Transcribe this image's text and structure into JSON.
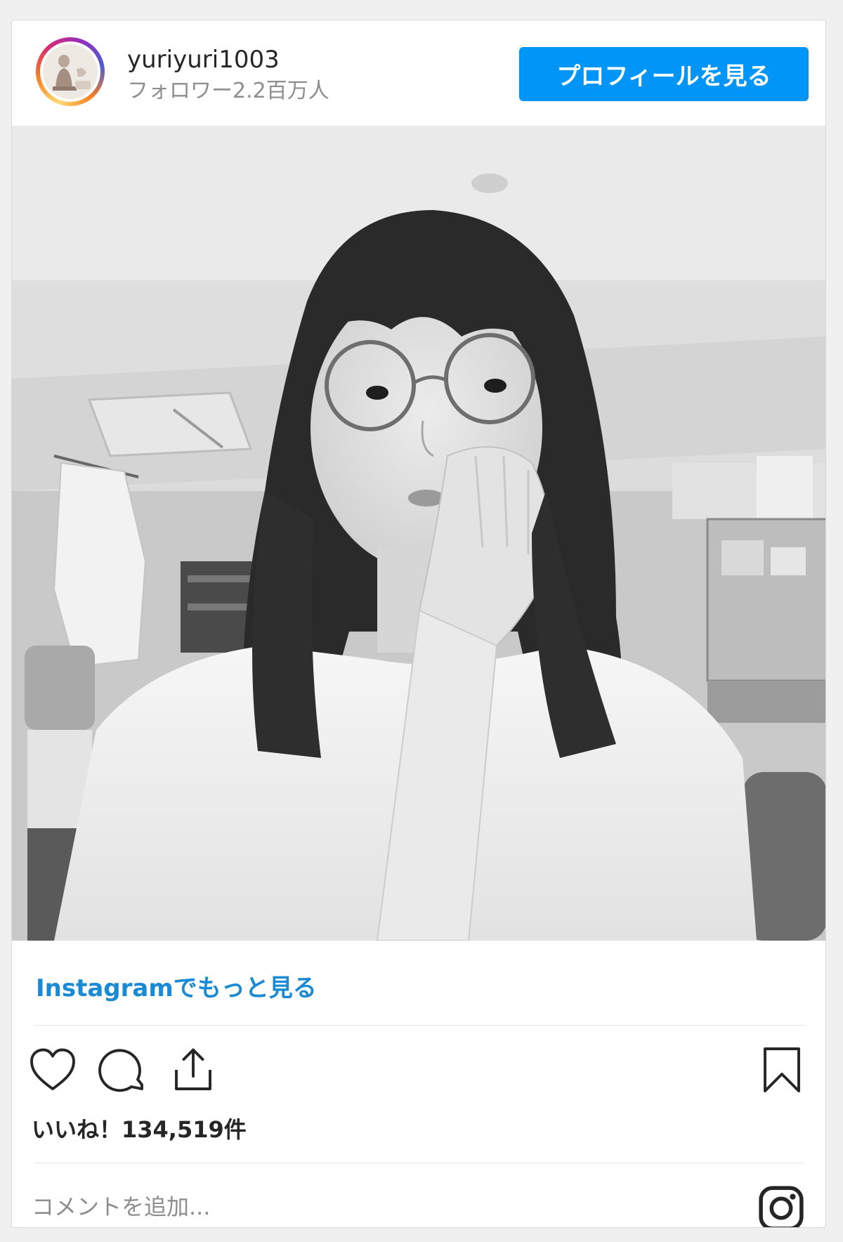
{
  "header": {
    "username": "yuriyuri1003",
    "followers": "フォロワー2.2百万人",
    "profile_button": "プロフィールを見る"
  },
  "post": {
    "image_alt": "",
    "more_link": "Instagramでもっと見る",
    "likes": "いいね！134,519件"
  },
  "comment": {
    "placeholder": "コメントを追加..."
  },
  "icons": {
    "like": "heart-icon",
    "comment": "comment-icon",
    "share": "share-icon",
    "save": "bookmark-icon",
    "logo": "instagram-logo-icon"
  },
  "colors": {
    "accent": "#0095f6",
    "link": "#1a8ad4",
    "secondary_text": "#8e8e8e"
  }
}
